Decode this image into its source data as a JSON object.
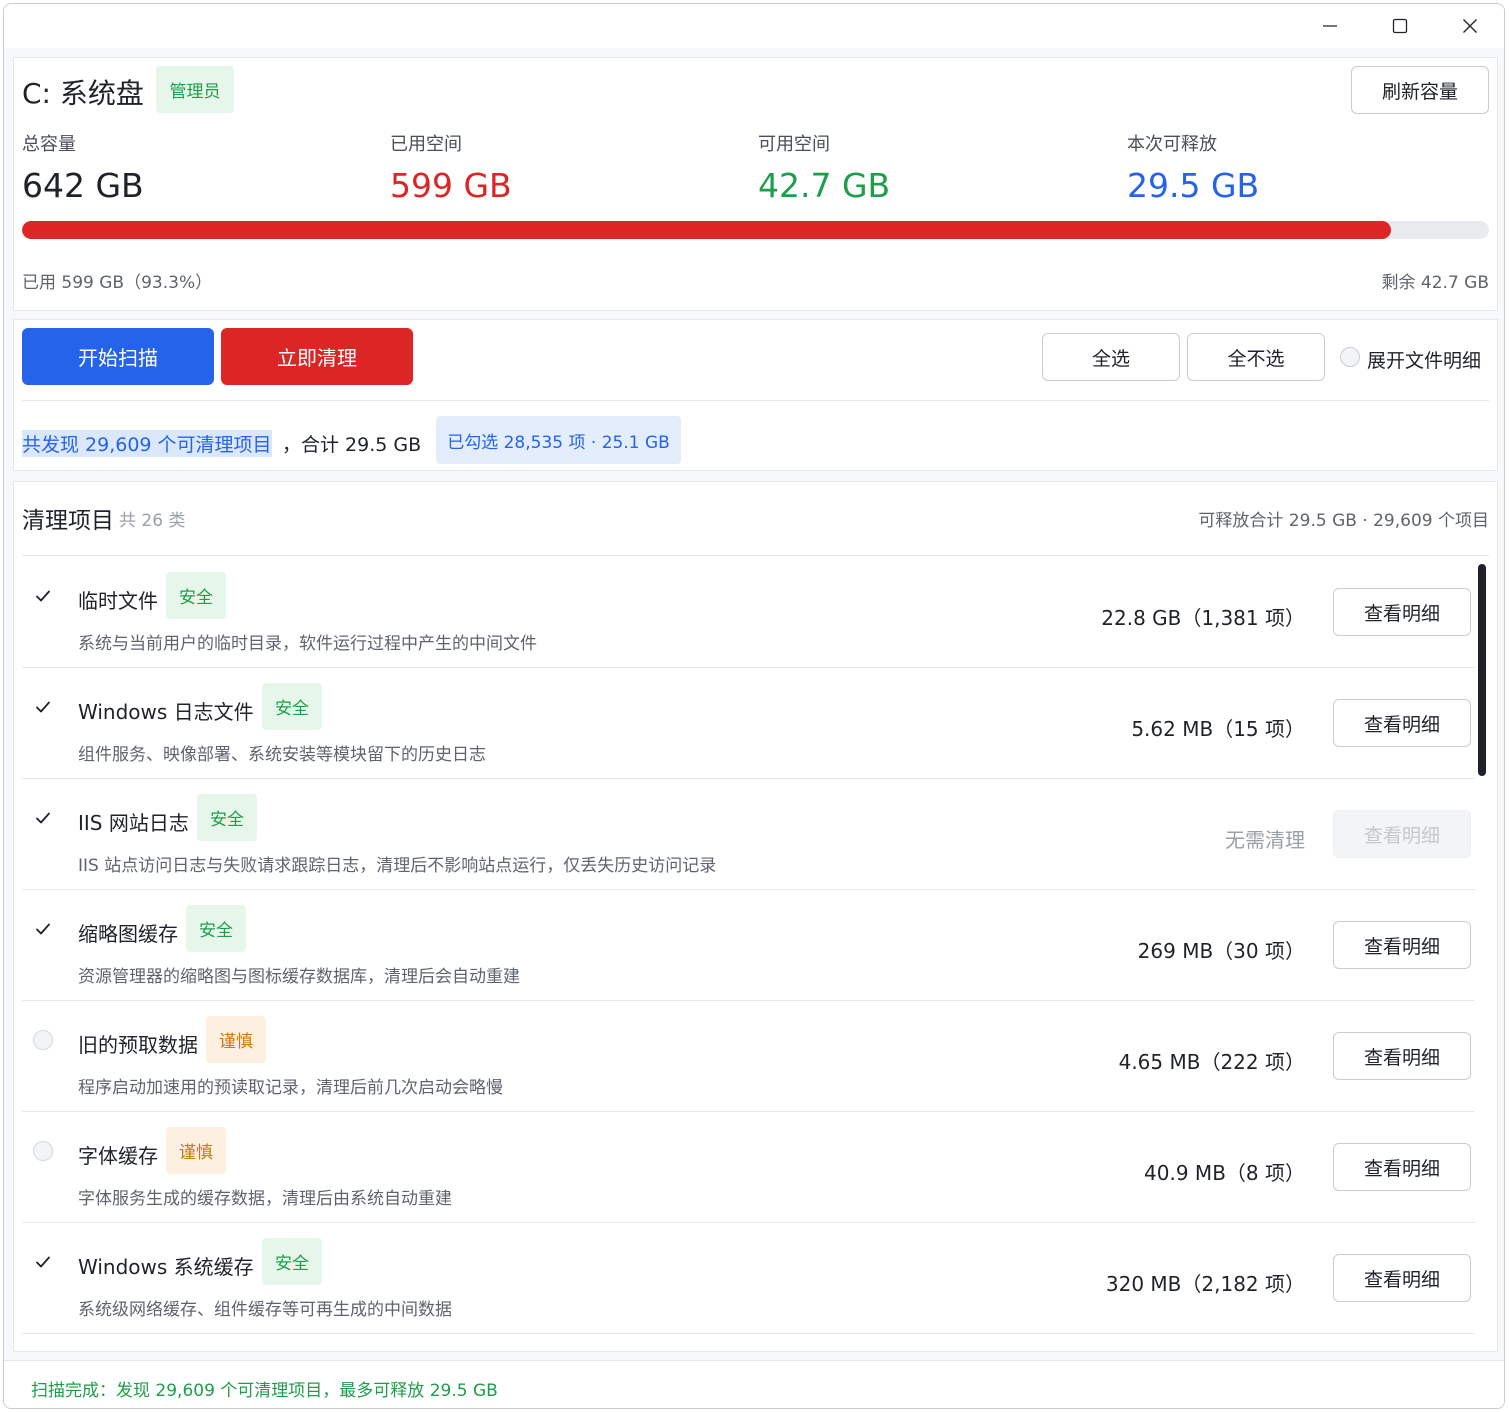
{
  "window": {
    "minimize_icon": "minimize-icon",
    "maximize_icon": "maximize-icon",
    "close_icon": "close-icon"
  },
  "drive": {
    "title": "C: 系统盘",
    "role_badge": "管理员",
    "refresh_label": "刷新容量",
    "stats": [
      {
        "label": "总容量",
        "value": "642 GB",
        "color": "#1f2329"
      },
      {
        "label": "已用空间",
        "value": "599 GB",
        "color": "#dc2626"
      },
      {
        "label": "可用空间",
        "value": "42.7 GB",
        "color": "#1e9e4a"
      },
      {
        "label": "本次可释放",
        "value": "29.5 GB",
        "color": "#2563eb"
      }
    ],
    "usage_fraction": 0.933,
    "used_text": "已用 599 GB（93.3%）",
    "remaining_text": "剩余 42.7 GB"
  },
  "actions": {
    "scan_label": "开始扫描",
    "clean_label": "立即清理",
    "select_all_label": "全选",
    "select_none_label": "全不选",
    "expand_label": "展开文件明细",
    "found_text": "共发现 29,609 个可清理项目",
    "total_text": "，合计 29.5 GB",
    "selected_text": "已勾选 28,535 项 · 25.1 GB"
  },
  "list": {
    "title": "清理项目",
    "count_text": "共 26 类",
    "summary_text": "可释放合计 29.5 GB · 29,609 个项目",
    "detail_label": "查看明细",
    "items": [
      {
        "name": "临时文件",
        "badge": "安全",
        "risk": "safe",
        "checked": true,
        "desc": "系统与当前用户的临时目录，软件运行过程中产生的中间文件",
        "size": "22.8 GB（1,381 项）",
        "enabled": true
      },
      {
        "name": "Windows 日志文件",
        "badge": "安全",
        "risk": "safe",
        "checked": true,
        "desc": "组件服务、映像部署、系统安装等模块留下的历史日志",
        "size": "5.62 MB（15 项）",
        "enabled": true
      },
      {
        "name": "IIS 网站日志",
        "badge": "安全",
        "risk": "safe",
        "checked": true,
        "desc": "IIS 站点访问日志与失败请求跟踪日志，清理后不影响站点运行，仅丢失历史访问记录",
        "size": "无需清理",
        "enabled": false
      },
      {
        "name": "缩略图缓存",
        "badge": "安全",
        "risk": "safe",
        "checked": true,
        "desc": "资源管理器的缩略图与图标缓存数据库，清理后会自动重建",
        "size": "269 MB（30 项）",
        "enabled": true
      },
      {
        "name": "旧的预取数据",
        "badge": "谨慎",
        "risk": "caution",
        "checked": false,
        "desc": "程序启动加速用的预读取记录，清理后前几次启动会略慢",
        "size": "4.65 MB（222 项）",
        "enabled": true
      },
      {
        "name": "字体缓存",
        "badge": "谨慎",
        "risk": "caution",
        "checked": false,
        "desc": "字体服务生成的缓存数据，清理后由系统自动重建",
        "size": "40.9 MB（8 项）",
        "enabled": true
      },
      {
        "name": "Windows 系统缓存",
        "badge": "安全",
        "risk": "safe",
        "checked": true,
        "desc": "系统级网络缓存、组件缓存等可再生成的中间数据",
        "size": "320 MB（2,182 项）",
        "enabled": true
      }
    ]
  },
  "status": {
    "text": "扫描完成：发现 29,609 个可清理项目，最多可释放 29.5 GB",
    "color": "#1e9e4a"
  }
}
